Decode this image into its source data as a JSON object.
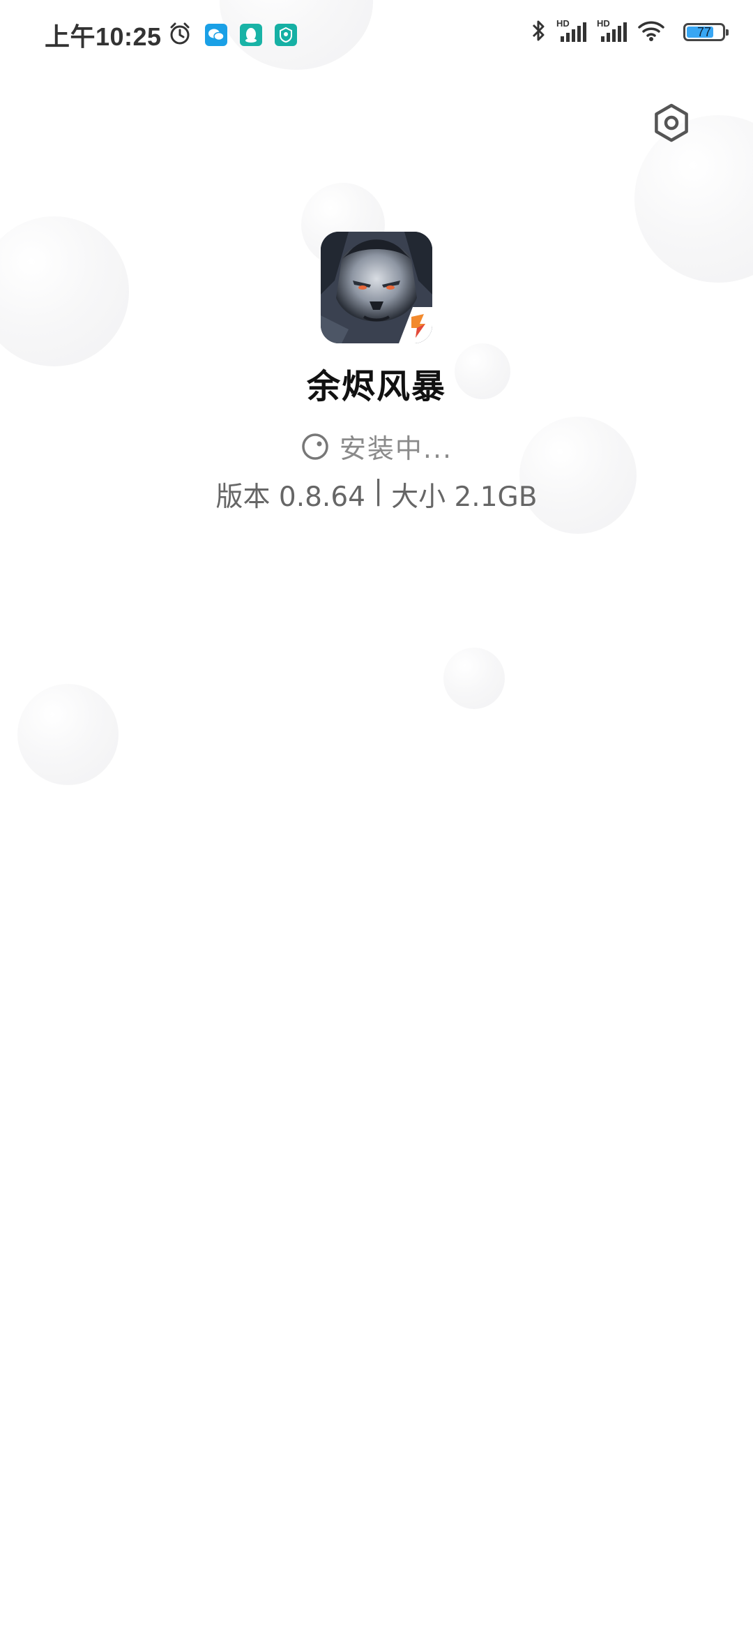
{
  "status_bar": {
    "time": "上午10:25",
    "left_icons": [
      "alarm-icon",
      "wechat-icon",
      "qq-icon",
      "game-helper-icon"
    ],
    "right_icons": [
      "bluetooth-icon",
      "signal-hd-icon",
      "signal-hd-icon",
      "wifi-icon",
      "battery-icon"
    ],
    "signal_label": "HD",
    "battery_level": "77",
    "battery_color": "#38a6f3"
  },
  "header": {
    "settings_icon": "settings-icon"
  },
  "app": {
    "name": "余烬风暴",
    "status_icon": "loading-icon",
    "status_text": "安装中...",
    "version_label": "版本 0.8.64",
    "separator": "|",
    "size_label": "大小 2.1GB",
    "badge_icon": "store-badge-icon"
  },
  "colors": {
    "background": "#ffffff",
    "secondary_text": "#666666",
    "status_text": "#8a8a8a"
  }
}
